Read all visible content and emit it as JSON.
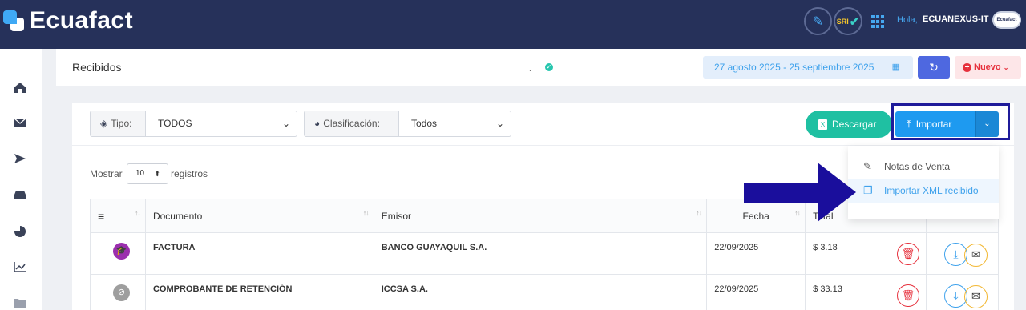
{
  "app": {
    "name": "Ecuafact"
  },
  "topbar": {
    "greeting": "Hola,",
    "username": "ECUANEXUS-IT",
    "sri_label": "SRI",
    "avatar_text": "Ecuafact"
  },
  "header": {
    "title": "Recibidos",
    "field_value": ".",
    "date_range": "27 agosto 2025 - 25 septiembre 2025",
    "new_label": "Nuevo"
  },
  "filters": {
    "tipo_label": "Tipo:",
    "tipo_value": "TODOS",
    "clasificacion_label": "Clasificación:",
    "clasificacion_value": "Todos"
  },
  "toolbar": {
    "download_label": "Descargar",
    "import_label": "Importar",
    "import_menu": [
      {
        "label": "Notas de Venta",
        "icon": "pencil-icon"
      },
      {
        "label": "Importar XML recibido",
        "icon": "copy-icon"
      }
    ]
  },
  "length": {
    "prefix": "Mostrar",
    "value": "10",
    "suffix": "registros"
  },
  "table": {
    "columns": [
      "Documento",
      "Emisor",
      "Fecha",
      "Total"
    ],
    "rows": [
      {
        "type_icon": "graduation-cap-icon",
        "type_color": "#9b2fae",
        "documento": "FACTURA",
        "emisor": "BANCO GUAYAQUIL S.A.",
        "fecha": "22/09/2025",
        "total": "$ 3.18"
      },
      {
        "type_icon": "ban-icon",
        "type_color": "#9e9e9e",
        "documento": "COMPROBANTE DE RETENCIÓN",
        "emisor": "ICCSA S.A.",
        "fecha": "22/09/2025",
        "total": "$ 33.13"
      }
    ]
  },
  "colors": {
    "topbar": "#26315a",
    "accent": "#1e9af0",
    "teal": "#1fc0a2",
    "danger": "#e6303c",
    "highlight": "#1f1b9a"
  }
}
